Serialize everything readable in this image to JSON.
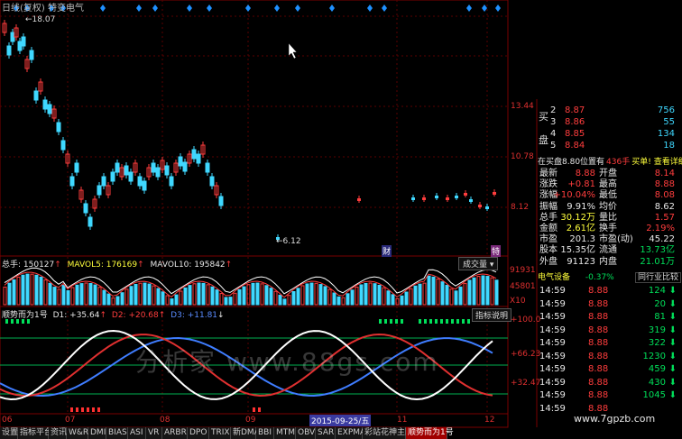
{
  "top": {
    "title": "日线(复权) 特变电气",
    "high_mark": "18.07"
  },
  "price_axis": [
    "13.44",
    "10.78",
    "8.12"
  ],
  "low_mark": "6.12",
  "marks": {
    "cai": "财",
    "te": "特"
  },
  "volume": {
    "label_total": "总手: 150127",
    "label_ma5": "MAVOL5: 176169",
    "label_ma10": "MAVOL10: 195842",
    "button": "成交量",
    "axis_top": "91931",
    "axis_mid": "45801",
    "axis_unit": "X10"
  },
  "indicator": {
    "label_name": "顺势而为1号",
    "label_d1": "D1: +35.64",
    "label_d2": "D2: +20.68",
    "label_d3": "D3: +11.81",
    "help_button": "指标说明",
    "axis": [
      "+100.0",
      "+66.23",
      "+32.47"
    ]
  },
  "date_axis": {
    "labels": [
      "06",
      "07",
      "08",
      "09",
      "11",
      "12"
    ],
    "cursor": "2015-09-25/五"
  },
  "tabs": [
    "设置",
    "指标平台",
    "资讯",
    "W&R",
    "DMI",
    "BIAS",
    "ASI",
    "VR",
    "ARBR",
    "DPO",
    "TRIX",
    "新DMA",
    "BBI",
    "MTM",
    "OBV",
    "SAR",
    "EXPMA",
    "彩站花神主图",
    "顺势而为1号"
  ],
  "order_book": {
    "sell": [
      {
        "level": "2",
        "price": "8.87",
        "vol": "756"
      },
      {
        "level": "3",
        "price": "8.86",
        "vol": "55"
      },
      {
        "level": "4",
        "price": "8.85",
        "vol": "134"
      },
      {
        "level": "5",
        "price": "8.84",
        "vol": "18"
      }
    ],
    "side_labels": [
      "买",
      "盘"
    ],
    "notice": "在买盘8.80位置有",
    "notice_num": "436手",
    "notice_link": "买单! 查看详细"
  },
  "quote": [
    {
      "l": "最新",
      "v": "8.88",
      "l2": "开盘",
      "v2": "8.14"
    },
    {
      "l": "涨跌",
      "v": "+0.81",
      "l2": "最高",
      "v2": "8.88"
    },
    {
      "l": "涨幅",
      "v": "+10.04%",
      "l2": "最低",
      "v2": "8.08"
    },
    {
      "l": "振幅",
      "v": "9.91%",
      "l2": "均价",
      "v2": "8.62"
    },
    {
      "l": "总手",
      "v": "30.12万",
      "l2": "量比",
      "v2": "1.57"
    },
    {
      "l": "金额",
      "v": "2.61亿",
      "l2": "换手",
      "v2": "2.19%"
    },
    {
      "l": "市盈",
      "v": "201.3",
      "l2": "市盈(动)",
      "v2": "45.22"
    },
    {
      "l": "股本",
      "v": "15.35亿",
      "l2": "流通",
      "v2": "13.73亿"
    },
    {
      "l": "外盘",
      "v": "91123",
      "l2": "内盘",
      "v2": "21.01万"
    }
  ],
  "sector": {
    "name": "电气设备",
    "change": "-0.37%",
    "compare": "同行业比较"
  },
  "ticks": [
    {
      "t": "14:59",
      "p": "8.88",
      "v": "124"
    },
    {
      "t": "14:59",
      "p": "8.88",
      "v": "20"
    },
    {
      "t": "14:59",
      "p": "8.88",
      "v": "81"
    },
    {
      "t": "14:59",
      "p": "8.88",
      "v": "319"
    },
    {
      "t": "14:59",
      "p": "8.88",
      "v": "322"
    },
    {
      "t": "14:59",
      "p": "8.88",
      "v": "1230"
    },
    {
      "t": "14:59",
      "p": "8.88",
      "v": "459"
    },
    {
      "t": "14:59",
      "p": "8.88",
      "v": "430"
    },
    {
      "t": "14:59",
      "p": "8.88",
      "v": "1045"
    },
    {
      "t": "14:59",
      "p": "8.88",
      "v": ""
    }
  ],
  "watermark": "分析家  www.88gs.com",
  "site_watermark": "www.7gpzb.com",
  "colors": {
    "up": "#ff3d3d",
    "down": "#00e05a",
    "candle_up": "#ff3d3d",
    "candle_down": "#3fd8ff",
    "ma5": "#ffffff",
    "ma10": "#ff3d3d",
    "d3": "#3f7dff"
  }
}
